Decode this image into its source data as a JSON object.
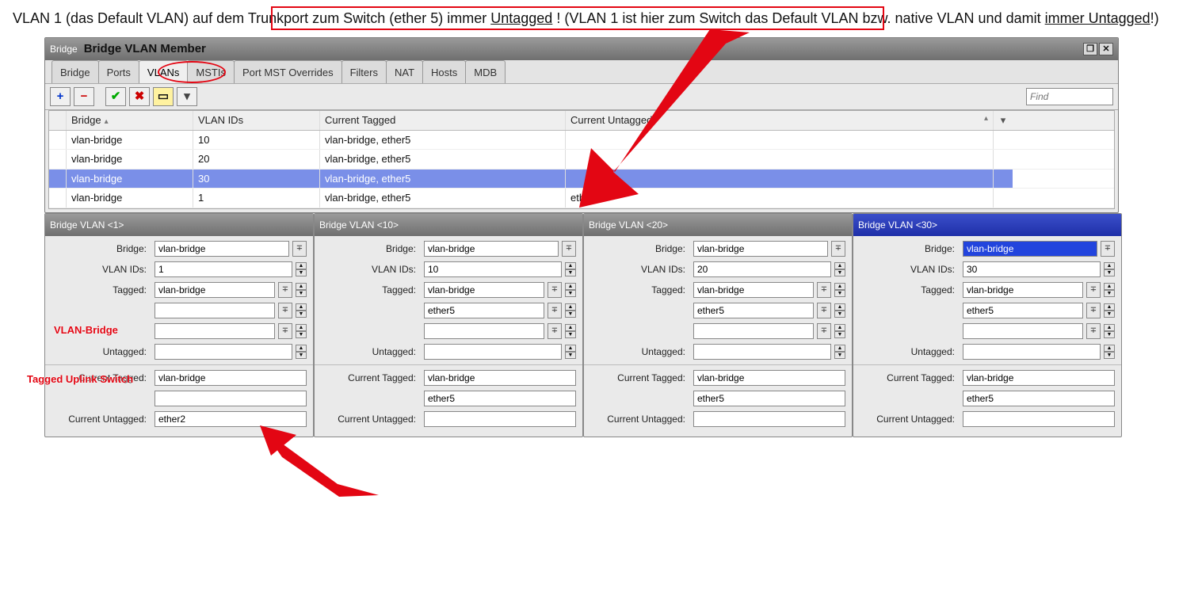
{
  "intro": {
    "pre": "VLAN 1 (das Default VLAN",
    "mid": ") auf dem Trunkport zum Switch (ether 5) immer ",
    "u1": "Untagged",
    "exclam": " ! ",
    "post1": "(VLAN 1 ist hier zum Switch das Default VLAN bzw. native VLAN und damit ",
    "u2": "immer Untagged",
    "post2": "!)"
  },
  "mainWindow": {
    "titlePrefix": "Bridge",
    "title": "Bridge VLAN Member",
    "tabs": [
      "Bridge",
      "Ports",
      "VLANs",
      "MSTIs",
      "Port MST Overrides",
      "Filters",
      "NAT",
      "Hosts",
      "MDB"
    ],
    "activeTab": "VLANs",
    "cols": [
      "Bridge",
      "VLAN IDs",
      "Current Tagged",
      "Current Untagged"
    ],
    "rows": [
      {
        "bridge": "vlan-bridge",
        "ids": "10",
        "tagged": "vlan-bridge, ether5",
        "untagged": ""
      },
      {
        "bridge": "vlan-bridge",
        "ids": "20",
        "tagged": "vlan-bridge, ether5",
        "untagged": ""
      },
      {
        "bridge": "vlan-bridge",
        "ids": "30",
        "tagged": "vlan-bridge, ether5",
        "untagged": "",
        "selected": true
      },
      {
        "bridge": "vlan-bridge",
        "ids": "1",
        "tagged": "vlan-bridge, ether5",
        "untagged": "ether2"
      }
    ],
    "findPlaceholder": "Find"
  },
  "annotations": {
    "anno1": "VLAN-Bridge",
    "anno2": "Tagged Uplink Switch"
  },
  "labels": {
    "bridge": "Bridge:",
    "vlanIds": "VLAN IDs:",
    "tagged": "Tagged:",
    "untagged": "Untagged:",
    "curTagged": "Current Tagged:",
    "curUntagged": "Current Untagged:"
  },
  "panels": [
    {
      "title": "Bridge VLAN <1>",
      "bridge": "vlan-bridge",
      "ids": "1",
      "tagged": [
        "vlan-bridge",
        "",
        ""
      ],
      "untagged": "",
      "curTagged": [
        "vlan-bridge",
        ""
      ],
      "curUntagged": "ether2",
      "highlight": false
    },
    {
      "title": "Bridge VLAN <10>",
      "bridge": "vlan-bridge",
      "ids": "10",
      "tagged": [
        "vlan-bridge",
        "ether5",
        ""
      ],
      "untagged": "",
      "curTagged": [
        "vlan-bridge",
        "ether5"
      ],
      "curUntagged": "",
      "highlight": false
    },
    {
      "title": "Bridge VLAN <20>",
      "bridge": "vlan-bridge",
      "ids": "20",
      "tagged": [
        "vlan-bridge",
        "ether5",
        ""
      ],
      "untagged": "",
      "curTagged": [
        "vlan-bridge",
        "ether5"
      ],
      "curUntagged": "",
      "highlight": false
    },
    {
      "title": "Bridge VLAN <30>",
      "bridge": "vlan-bridge",
      "ids": "30",
      "tagged": [
        "vlan-bridge",
        "ether5",
        ""
      ],
      "untagged": "",
      "curTagged": [
        "vlan-bridge",
        "ether5"
      ],
      "curUntagged": "",
      "highlight": true
    }
  ]
}
